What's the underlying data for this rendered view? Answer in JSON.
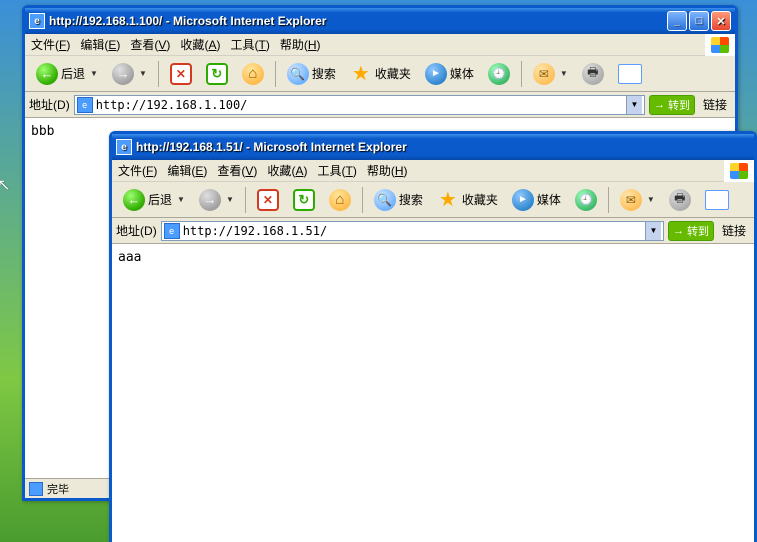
{
  "menus": {
    "file": "文件",
    "edit": "编辑",
    "view": "查看",
    "fav": "收藏",
    "tools": "工具",
    "help": "帮助",
    "file_u": "F",
    "edit_u": "E",
    "view_u": "V",
    "fav_u": "A",
    "tools_u": "T",
    "help_u": "H"
  },
  "toolbar": {
    "back": "后退",
    "search": "搜索",
    "favorites": "收藏夹",
    "media": "媒体"
  },
  "addrbar": {
    "label": "地址",
    "label_u": "D",
    "go": "转到",
    "links": "链接"
  },
  "win1": {
    "title": "http://192.168.1.100/ - Microsoft Internet Explorer",
    "url": "http://192.168.1.100/",
    "body": "bbb",
    "status": "完毕"
  },
  "win2": {
    "title": "http://192.168.1.51/ - Microsoft Internet Explorer",
    "url": "http://192.168.1.51/",
    "body": "aaa"
  }
}
